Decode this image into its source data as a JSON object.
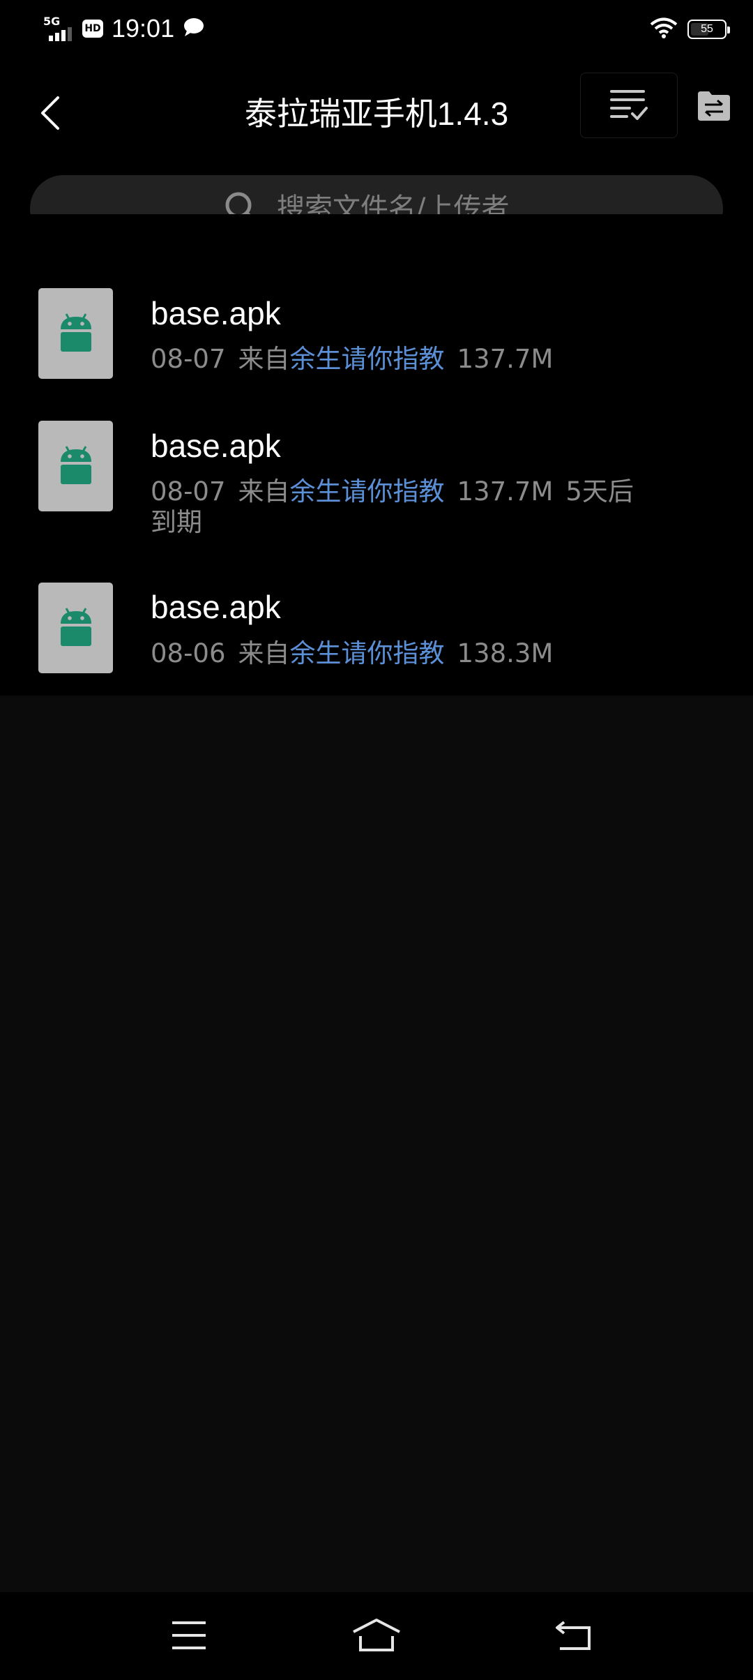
{
  "status_bar": {
    "network": "5G",
    "hd": "HD",
    "time": "19:01",
    "battery": "55",
    "battery_level": 0.55,
    "icons": [
      "signal-icon",
      "hd-icon",
      "message-icon",
      "wifi-icon",
      "battery-icon"
    ]
  },
  "header": {
    "title": "泰拉瑞亚手机1.4.3",
    "back_icon": "back-arrow-icon",
    "select_icon": "list-check-icon",
    "transfer_icon": "file-transfer-icon"
  },
  "search": {
    "placeholder": "搜索文件名/上传者",
    "icon": "search-icon"
  },
  "files": [
    {
      "name": "base.apk",
      "date": "08-07",
      "from_prefix": "来自",
      "uploader": "余生请你指教",
      "size": "137.7M",
      "expiry": ""
    },
    {
      "name": "base.apk",
      "date": "08-07",
      "from_prefix": "来自",
      "uploader": "余生请你指教",
      "size": "137.7M",
      "expiry": "5天后到期"
    },
    {
      "name": "base.apk",
      "date": "08-06",
      "from_prefix": "来自",
      "uploader": "余生请你指教",
      "size": "138.3M",
      "expiry": ""
    }
  ],
  "nav": {
    "menu_icon": "menu-icon",
    "home_icon": "home-icon",
    "back_icon": "back-icon"
  },
  "colors": {
    "background": "#0b0b0b",
    "surface": "#000000",
    "search_bg": "#222222",
    "accent_link": "#5b8fd6",
    "meta_text": "#8c8c8c",
    "apk_green": "#1a8a6a"
  }
}
